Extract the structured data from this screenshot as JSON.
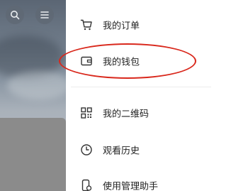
{
  "left_pane": {
    "search_button_icon": "search-icon",
    "menu_button_icon": "menu-icon"
  },
  "drawer": {
    "items": [
      {
        "label": "我的订单",
        "icon": "cart-icon"
      },
      {
        "label": "我的钱包",
        "icon": "wallet-icon"
      },
      {
        "label": "我的二维码",
        "icon": "qr-code-icon"
      },
      {
        "label": "观看历史",
        "icon": "clock-icon"
      },
      {
        "label": "使用管理助手",
        "icon": "phone-manager-icon"
      }
    ]
  },
  "colors": {
    "highlight": "#d9281c",
    "text": "#222222",
    "icon": "#333333"
  }
}
